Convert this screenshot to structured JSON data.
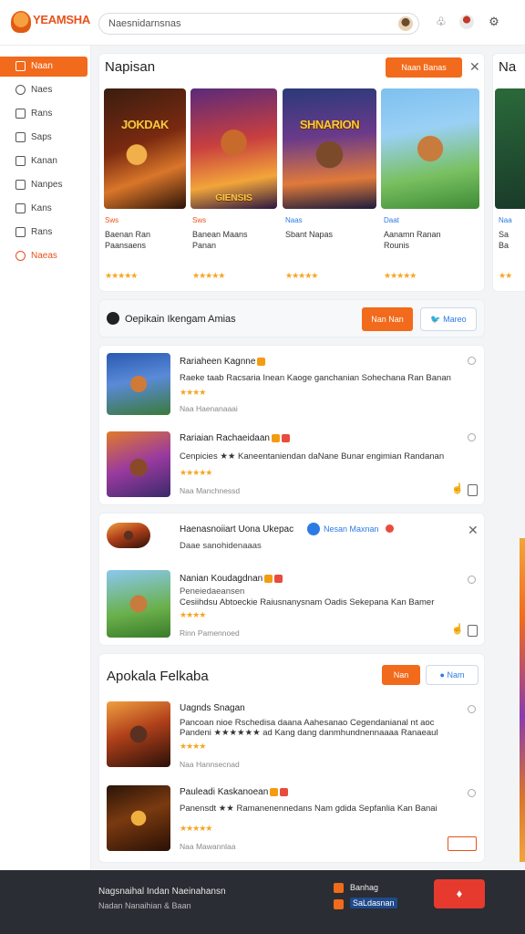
{
  "header": {
    "logo_text": "YEAMSHA",
    "search_placeholder": "Naesnidarnsnas"
  },
  "sidebar": {
    "items": [
      {
        "label": "Naan",
        "icon": "home-icon"
      },
      {
        "label": "Naes",
        "icon": "chat-icon"
      },
      {
        "label": "Rans",
        "icon": "square-icon"
      },
      {
        "label": "Saps",
        "icon": "list-icon"
      },
      {
        "label": "Kanan",
        "icon": "grid-icon"
      },
      {
        "label": "Nanpes",
        "icon": "box-icon"
      },
      {
        "label": "Kans",
        "icon": "tag-icon"
      },
      {
        "label": "Rans",
        "icon": "image-icon"
      },
      {
        "label": "Naeas",
        "icon": "fire-icon"
      }
    ]
  },
  "featured": {
    "title": "Napisan",
    "action_label": "Naan Banas",
    "next_title": "Na",
    "games": [
      {
        "tag": "Sws",
        "name": "Baenan Ran",
        "name2": "Paansaens",
        "thumb_title": "JOKDAK",
        "rating": "★★★★★"
      },
      {
        "tag": "Sws",
        "name": "Banean Maans",
        "name2": "Panan",
        "thumb_title": "",
        "thumb_foot": "GIENSIS",
        "rating": "★★★★★"
      },
      {
        "tag": "Naas",
        "name": "Sbant Napas",
        "name2": "",
        "thumb_title": "SHNARION",
        "rating": "★★★★★"
      },
      {
        "tag": "Daat",
        "name": "Aanamn Ranan",
        "name2": "Rounis",
        "thumb_title": "",
        "rating": "★★★★★"
      },
      {
        "tag": "Naa",
        "name": "Sa",
        "name2": "Ba",
        "thumb_title": "",
        "rating": "★★"
      }
    ]
  },
  "section1": {
    "title": "Oepikain Ikengam Amias",
    "primary_label": "Nan Nan",
    "secondary_label": "Mareo",
    "items": [
      {
        "title": "Rariaheen Kagnne",
        "desc": "Raeke taab Racsaria Inean Kaoge ganchanian Sohechana Ran Banan",
        "rating": "★★★★",
        "meta": "Naa Haenanaaai"
      },
      {
        "title": "Rariaian Rachaeidaan",
        "desc": "Cenpicies ★★ Kaneentaniendan daNane Bunar engimian Randanan",
        "rating": "★★★★★",
        "meta": "Naa Manchnessd"
      }
    ]
  },
  "section2": {
    "title": "Haenasnoiiart Uona Ukepac",
    "chip_label": "Nesan Maxnan",
    "subtitle": "Daae sanohidenaaas",
    "item": {
      "title": "Nanian Koudagdnan",
      "desc": "Cesiihdsu Abtoeckie Raiusnanysnam Oadis Sekepana Kan Bamer",
      "sub": "Peneiedaeansen",
      "rating": "★★★★",
      "meta": "Rinn Pamennoed"
    }
  },
  "section3": {
    "title": "Apokala Felkaba",
    "primary_label": "Nan",
    "secondary_label": "Nam",
    "items": [
      {
        "title": "Uagnds Snagan",
        "desc": "Pancoan nioe Rschedisa daana Aahesanao Cegendanianal nt aoc",
        "desc2": "Pandeni ★★★★★★ ad Kang dang danmhundnennaaaa Ranaeaul",
        "rating": "★★★★",
        "meta": "Naa Hannsecnad"
      },
      {
        "title": "Pauleadi Kaskanoean",
        "desc": "Panensdt ★★ Ramanenennedans Nam gdida Sepfanlia Kan Banai",
        "rating": "★★★★★",
        "meta": "Naa Mawannlaa"
      }
    ]
  },
  "footer": {
    "line1": "Nagsnaihal Indan Naeinahansn",
    "line2": "Nadan Nanaihian & Baan",
    "btn1": "Banhag",
    "btn2": "SaLdasnan"
  }
}
